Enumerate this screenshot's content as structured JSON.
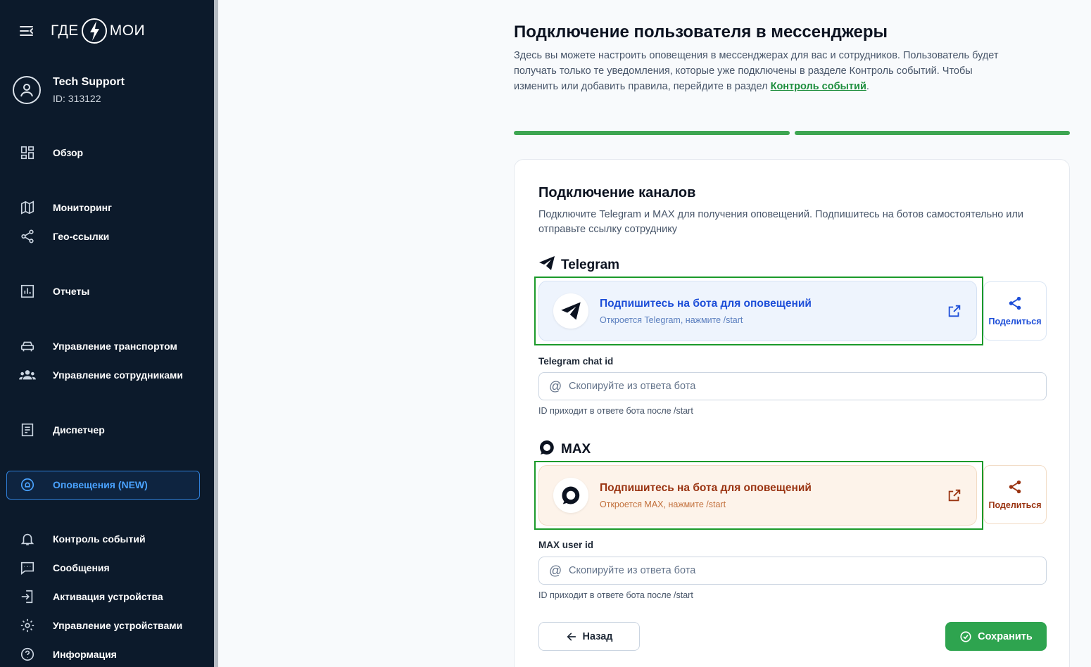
{
  "sidebar": {
    "logo_left": "ГДЕ",
    "logo_right": "МОИ",
    "user": {
      "name": "Tech Support",
      "id": "ID: 313122"
    },
    "items": [
      {
        "label": "Обзор",
        "icon": "dashboard-icon"
      },
      {
        "label": "Мониторинг",
        "icon": "map-icon"
      },
      {
        "label": "Гео-ссылки",
        "icon": "share-icon"
      },
      {
        "label": "Отчеты",
        "icon": "bar-chart-icon"
      },
      {
        "label": "Управление транспортом",
        "icon": "car-icon"
      },
      {
        "label": "Управление сотрудниками",
        "icon": "users-icon"
      },
      {
        "label": "Диспетчер",
        "icon": "document-icon"
      },
      {
        "label": "Оповещения (NEW)",
        "icon": "alert-circle-icon",
        "active": true
      },
      {
        "label": "Контроль событий",
        "icon": "bell-icon"
      },
      {
        "label": "Сообщения",
        "icon": "chat-icon"
      },
      {
        "label": "Активация устройства",
        "icon": "login-icon"
      },
      {
        "label": "Управление устройствами",
        "icon": "gear-icon"
      },
      {
        "label": "Информация",
        "icon": "help-icon"
      }
    ]
  },
  "page": {
    "title": "Подключение пользователя в мессенджеры",
    "desc_text": "Здесь вы можете настроить оповещения в мессенджерах для вас и сотрудников. Пользователь будет получать только те уведомления, которые уже подключены в разделе Контроль событий. Чтобы изменить или добавить правила, перейдите в раздел ",
    "desc_link": "Контроль событий",
    "desc_end": "."
  },
  "card": {
    "title": "Подключение каналов",
    "desc": "Подключите Telegram и MAX для получения оповещений. Подпишитесь на ботов самостоятельно или отправьте ссылку сотруднику",
    "telegram": {
      "name": "Telegram",
      "bot_title": "Подпишитесь на бота для оповещений",
      "bot_sub": "Откроется Telegram, нажмите /start",
      "share_label": "Поделиться",
      "field_label": "Telegram chat id",
      "field_placeholder": "Скопируйте из ответа бота",
      "field_value": "",
      "hint": "ID приходит в ответе бота после /start"
    },
    "max": {
      "name": "MAX",
      "bot_title": "Подпишитесь на бота для оповещений",
      "bot_sub": "Откроется MAX, нажмите /start",
      "share_label": "Поделиться",
      "field_label": "MAX user id",
      "field_placeholder": "Скопируйте из ответа бота",
      "field_value": "",
      "hint": "ID приходит в ответе бота после /start"
    },
    "back_label": "Назад",
    "save_label": "Сохранить"
  },
  "colors": {
    "sidebar_bg": "#0c1a2b",
    "accent_green": "#2ea44f",
    "active_blue": "#4aa3ff",
    "telegram_blue": "#1d4ed8",
    "max_brown": "#9a3412"
  }
}
